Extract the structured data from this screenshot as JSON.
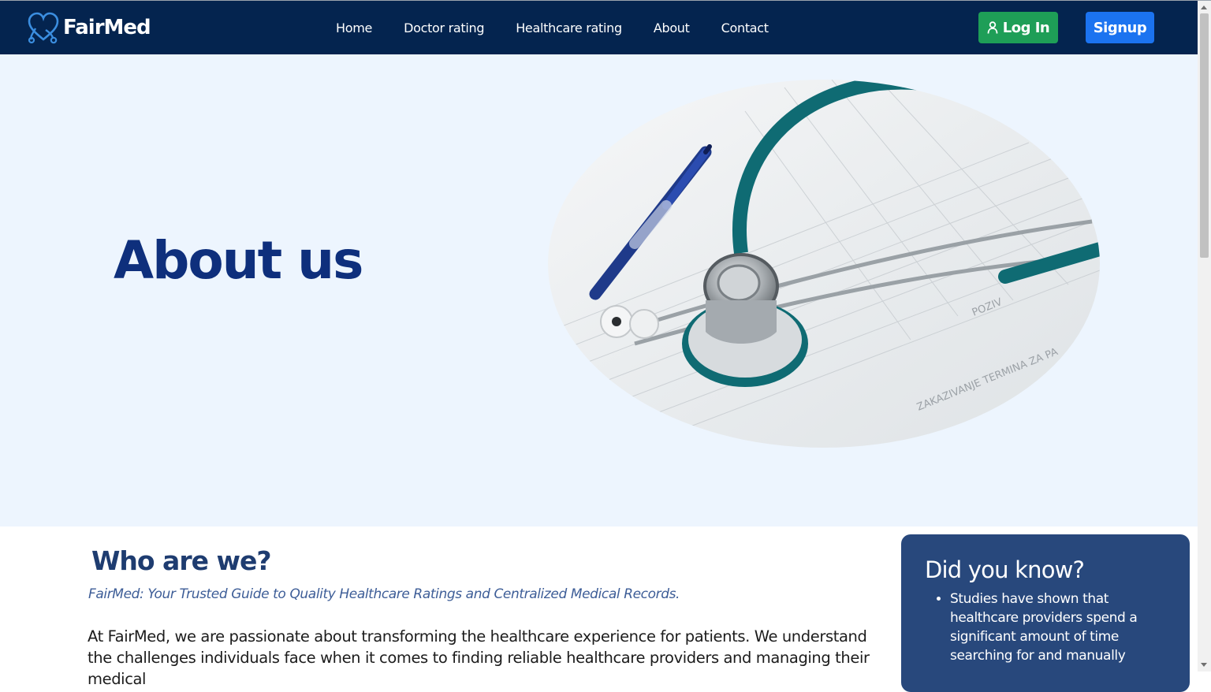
{
  "header": {
    "brand": "FairMed",
    "nav": [
      "Home",
      "Doctor rating",
      "Healthcare rating",
      "About",
      "Contact"
    ],
    "login_label": "Log In",
    "signup_label": "Signup"
  },
  "hero": {
    "title": "About us",
    "image_alt": "stethoscope and pen on medical forms"
  },
  "who": {
    "title": "Who are we?",
    "tagline": "FairMed: Your Trusted Guide to Quality Healthcare Ratings and Centralized Medical Records.",
    "paragraph": "At FairMed, we are passionate about transforming the healthcare experience for patients. We understand the challenges individuals face when it comes to finding reliable healthcare providers and managing their medical"
  },
  "did_you_know": {
    "title": "Did you know?",
    "items": [
      "Studies have shown that healthcare providers spend a significant amount of time searching for and manually"
    ]
  },
  "colors": {
    "navbar": "#04244f",
    "login": "#1e9e57",
    "signup": "#1b73f0",
    "hero_bg": "#edf5fe",
    "hero_title": "#0e2f7c",
    "card_bg": "#28487c"
  }
}
